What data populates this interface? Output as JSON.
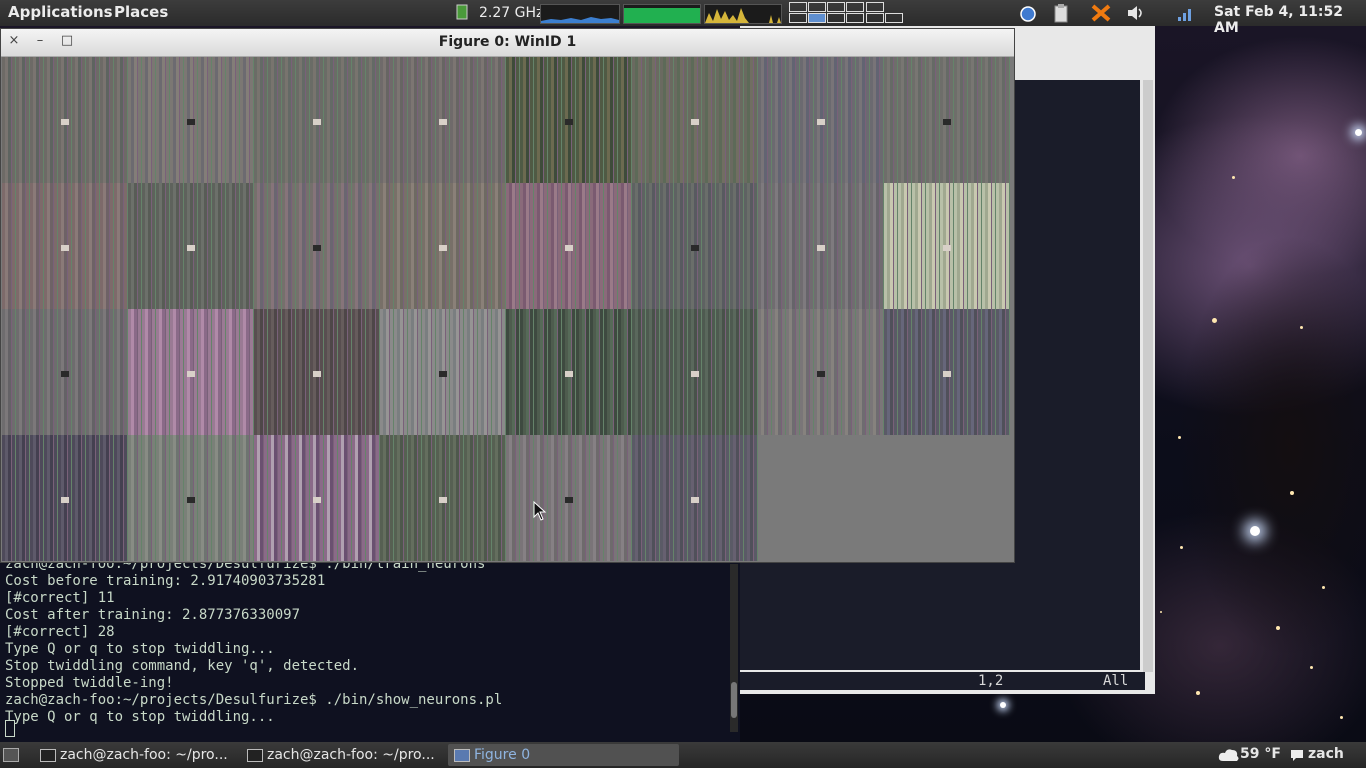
{
  "top_panel": {
    "menus": [
      "Applications",
      "Places"
    ],
    "cpu_freq": "2.27 GHz",
    "clock": "Sat Feb  4, 11:52 AM",
    "icons": [
      "cpu-chip-icon",
      "network-graph-icon",
      "memory-graph-icon",
      "load-graph-icon",
      "workspace-switcher-icon",
      "screenshot-icon",
      "clipboard-icon",
      "close-x-icon",
      "volume-icon",
      "signal-icon"
    ]
  },
  "figure_window": {
    "title": "Figure 0:  WinID 1",
    "buttons": [
      "×",
      "–",
      "□"
    ],
    "tile_count": 30,
    "grid": {
      "columns": 8,
      "rows": 4
    }
  },
  "terminal": {
    "lines": [
      "zach@zach-foo:~/projects/Desulfurize$ ./bin/train_neurons",
      "Cost before training: 2.91740903735281",
      "[#correct] 11",
      "Cost after training: 2.877376330097",
      "[#correct] 28",
      "Type Q or q to stop twiddling...",
      "Stop twiddling command, key 'q', detected.",
      "Stopped twiddle-ing!",
      "zach@zach-foo:~/projects/Desulfurize$ ./bin/show_neurons.pl",
      "Type Q or q to stop twiddling..."
    ]
  },
  "vim": {
    "position": "1,2",
    "scroll": "All"
  },
  "bottom_panel": {
    "tasks": [
      {
        "label": "zach@zach-foo: ~/pro...",
        "active": false
      },
      {
        "label": "zach@zach-foo: ~/pro...",
        "active": false
      },
      {
        "label": "Figure 0",
        "active": true
      }
    ],
    "weather": "59 °F",
    "user": "zach"
  }
}
